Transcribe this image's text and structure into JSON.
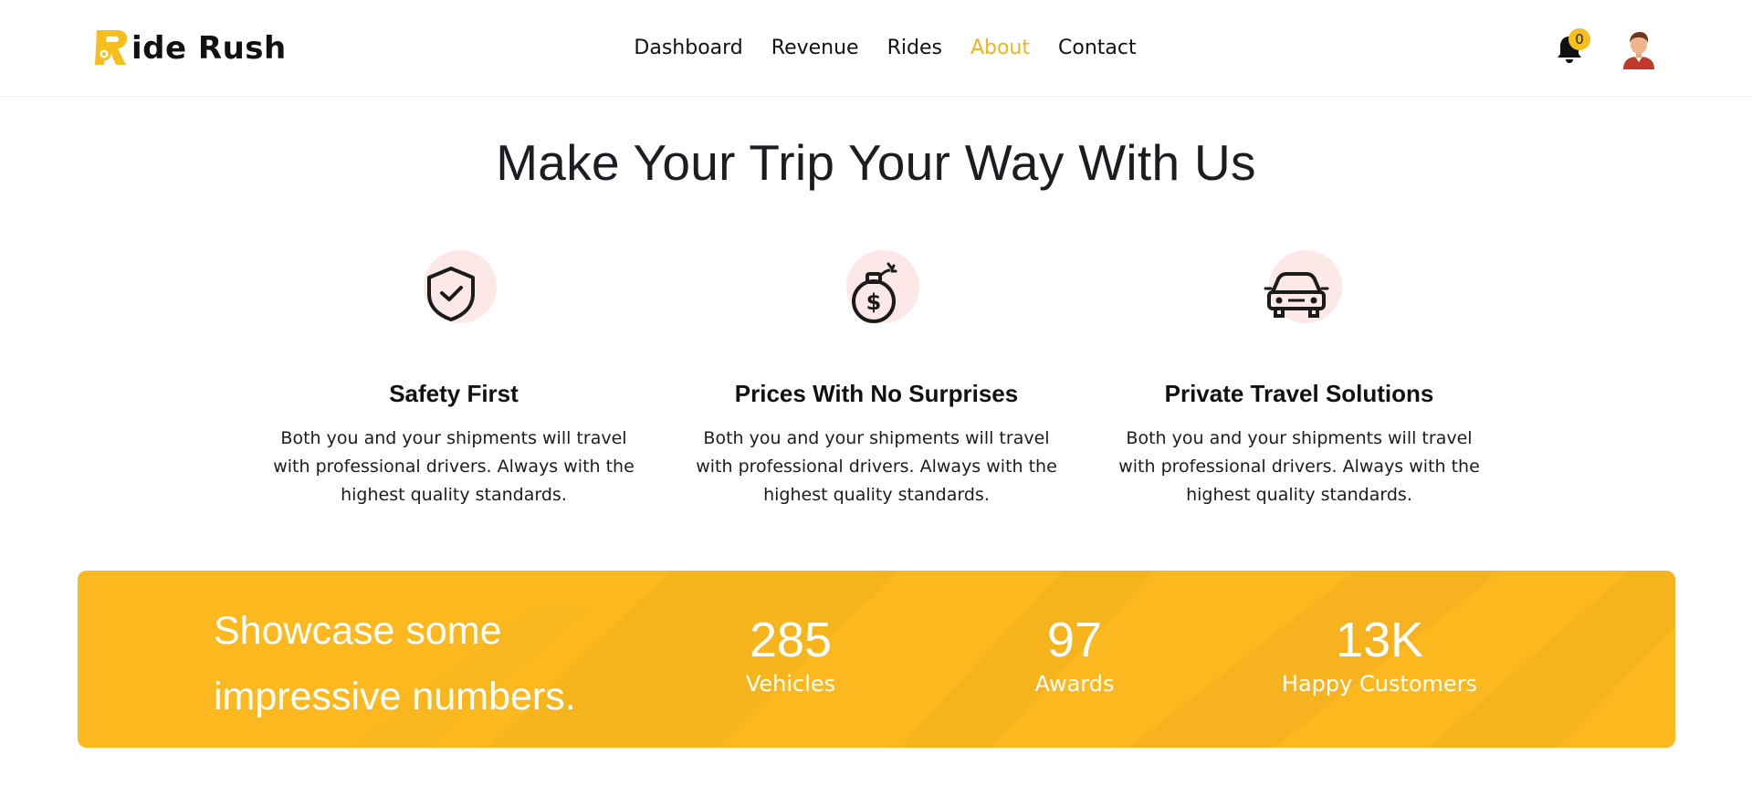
{
  "header": {
    "logo_text": "ide Rush",
    "nav": [
      {
        "label": "Dashboard"
      },
      {
        "label": "Revenue"
      },
      {
        "label": "Rides"
      },
      {
        "label": "About",
        "active": true
      },
      {
        "label": "Contact"
      }
    ],
    "notification_count": "0",
    "bell_icon": "bell-icon",
    "avatar_icon": "user-avatar-icon"
  },
  "main": {
    "title": "Make Your Trip Your Way With Us",
    "features": [
      {
        "icon": "shield-check-icon",
        "title": "Safety First",
        "text": "Both you and your shipments will travel with professional drivers. Always with the highest quality standards."
      },
      {
        "icon": "money-bag-icon",
        "title": "Prices With No Surprises",
        "text": "Both you and your shipments will travel with professional drivers. Always with the highest quality standards."
      },
      {
        "icon": "car-icon",
        "title": "Private Travel Solutions",
        "text": "Both you and your shipments will travel with professional drivers. Always with the highest quality standards."
      }
    ]
  },
  "stats": {
    "headline_line1": "Showcase some",
    "headline_line2": "impressive numbers.",
    "items": [
      {
        "value": "285",
        "label": "Vehicles"
      },
      {
        "value": "97",
        "label": "Awards"
      },
      {
        "value": "13K",
        "label": "Happy Customers"
      }
    ]
  },
  "colors": {
    "accent": "#f5b21c",
    "banner": "#fbb81f",
    "icon_bg": "#fde8e8"
  }
}
